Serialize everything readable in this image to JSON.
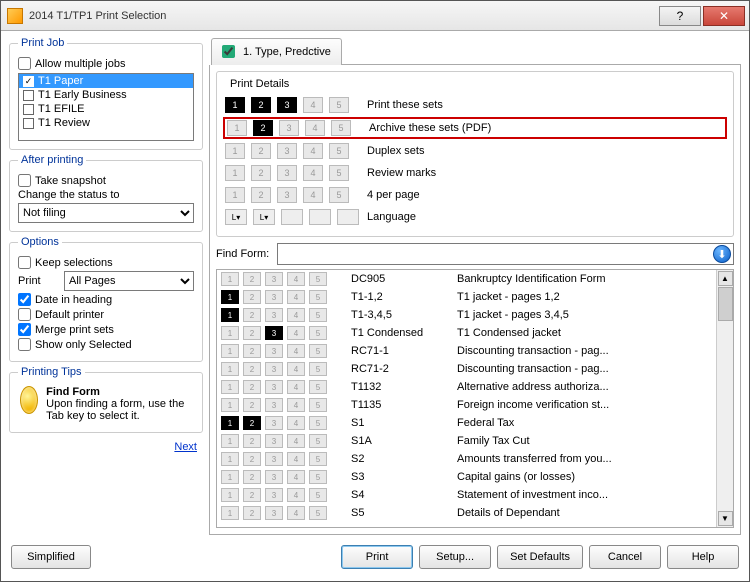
{
  "window": {
    "title": "2014 T1/TP1 Print Selection",
    "help_icon": "?",
    "close_icon": "✕"
  },
  "left": {
    "print_job_legend": "Print Job",
    "allow_multiple": "Allow multiple jobs",
    "jobs": [
      {
        "label": "T1 Paper",
        "checked": true,
        "selected": true
      },
      {
        "label": "T1 Early Business",
        "checked": false,
        "selected": false
      },
      {
        "label": "T1 EFILE",
        "checked": false,
        "selected": false
      },
      {
        "label": "T1 Review",
        "checked": false,
        "selected": false
      }
    ],
    "after_printing_legend": "After printing",
    "take_snapshot": "Take snapshot",
    "change_status_label": "Change the status to",
    "status_value": "Not filing",
    "options_legend": "Options",
    "keep_selections": "Keep selections",
    "print_label": "Print",
    "print_pages_value": "All Pages",
    "date_in_heading": "Date in heading",
    "default_printer": "Default printer",
    "merge_print_sets": "Merge print sets",
    "show_only_selected": "Show only Selected",
    "tips_legend": "Printing Tips",
    "tip_title": "Find Form",
    "tip_body": "Upon finding a form, use the Tab key to select it.",
    "next": "Next"
  },
  "tab": {
    "label": "1.  Type, Predctive"
  },
  "details": {
    "legend": "Print Details",
    "rows": [
      {
        "label": "Print these sets",
        "filled": [
          1,
          2,
          3
        ],
        "grey": [
          4,
          5
        ]
      },
      {
        "label": "Archive these sets (PDF)",
        "filled": [
          2
        ],
        "grey": [
          1,
          3,
          4,
          5
        ],
        "highlight": true
      },
      {
        "label": "Duplex sets",
        "filled": [],
        "grey": [
          1,
          2,
          3,
          4,
          5
        ]
      },
      {
        "label": "Review marks",
        "filled": [],
        "grey": [
          1,
          2,
          3,
          4,
          5
        ]
      },
      {
        "label": "4 per page",
        "filled": [],
        "grey": [
          1,
          2,
          3,
          4,
          5
        ]
      },
      {
        "label": "Language",
        "lang": true
      }
    ]
  },
  "find_label": "Find Form:",
  "forms": [
    {
      "s": [],
      "code": "DC905",
      "desc": "Bankruptcy Identification Form"
    },
    {
      "s": [
        1
      ],
      "code": "T1-1,2",
      "desc": "T1 jacket - pages 1,2"
    },
    {
      "s": [
        1
      ],
      "code": "T1-3,4,5",
      "desc": "T1 jacket - pages 3,4,5"
    },
    {
      "s": [
        3
      ],
      "code": "T1 Condensed",
      "desc": "T1 Condensed jacket"
    },
    {
      "s": [],
      "code": "RC71-1",
      "desc": "Discounting transaction - pag..."
    },
    {
      "s": [],
      "code": "RC71-2",
      "desc": "Discounting transaction - pag..."
    },
    {
      "s": [],
      "code": "T1132",
      "desc": "Alternative address authoriza..."
    },
    {
      "s": [],
      "code": "T1135",
      "desc": "Foreign income verification st..."
    },
    {
      "s": [
        1,
        2
      ],
      "code": "S1",
      "desc": "Federal Tax"
    },
    {
      "s": [],
      "code": "S1A",
      "desc": "Family Tax Cut"
    },
    {
      "s": [],
      "code": "S2",
      "desc": "Amounts transferred from you..."
    },
    {
      "s": [],
      "code": "S3",
      "desc": "Capital gains (or losses)"
    },
    {
      "s": [],
      "code": "S4",
      "desc": "Statement of investment inco..."
    },
    {
      "s": [],
      "code": "S5",
      "desc": "Details of Dependant"
    }
  ],
  "footer": {
    "simplified": "Simplified",
    "print": "Print",
    "setup": "Setup...",
    "set_defaults": "Set Defaults",
    "cancel": "Cancel",
    "help": "Help"
  }
}
